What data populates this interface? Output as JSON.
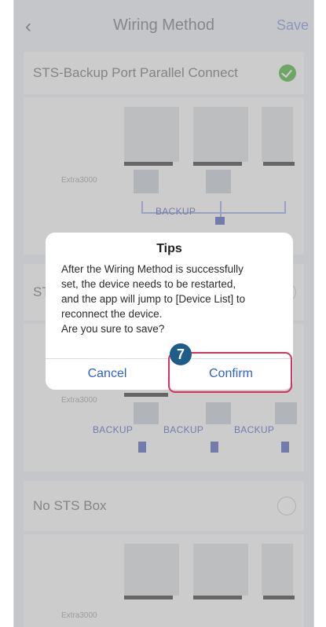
{
  "header": {
    "title": "Wiring Method",
    "save_label": "Save",
    "back_icon": "chevron-left-icon"
  },
  "options": [
    {
      "label": "STS-Backup Port Parallel Connect",
      "selected": true,
      "diagram": {
        "device_label": "Extra3000",
        "bus_label": "BACKUP"
      }
    },
    {
      "label": "ST",
      "selected": false,
      "diagram": {
        "device_label": "Extra3000",
        "port_labels": [
          "BACKUP",
          "BACKUP",
          "BACKUP"
        ]
      }
    },
    {
      "label": "No STS Box",
      "selected": false,
      "diagram": {
        "device_label": "Extra3000"
      }
    }
  ],
  "dialog": {
    "title": "Tips",
    "message_lines": [
      "After the Wiring Method is successfully",
      "set, the device needs to be restarted,",
      "and the app will jump to [Device List] to",
      "reconnect the device.",
      "Are you sure to save?"
    ],
    "cancel_label": "Cancel",
    "confirm_label": "Confirm"
  },
  "annotation": {
    "step_number": "7"
  },
  "colors": {
    "accent": "#2f5fd0",
    "highlight": "#d8315b",
    "check": "#6bbf5e",
    "step_badge": "#1e5d8a",
    "overlay": "rgba(120,120,120,0.35)"
  }
}
